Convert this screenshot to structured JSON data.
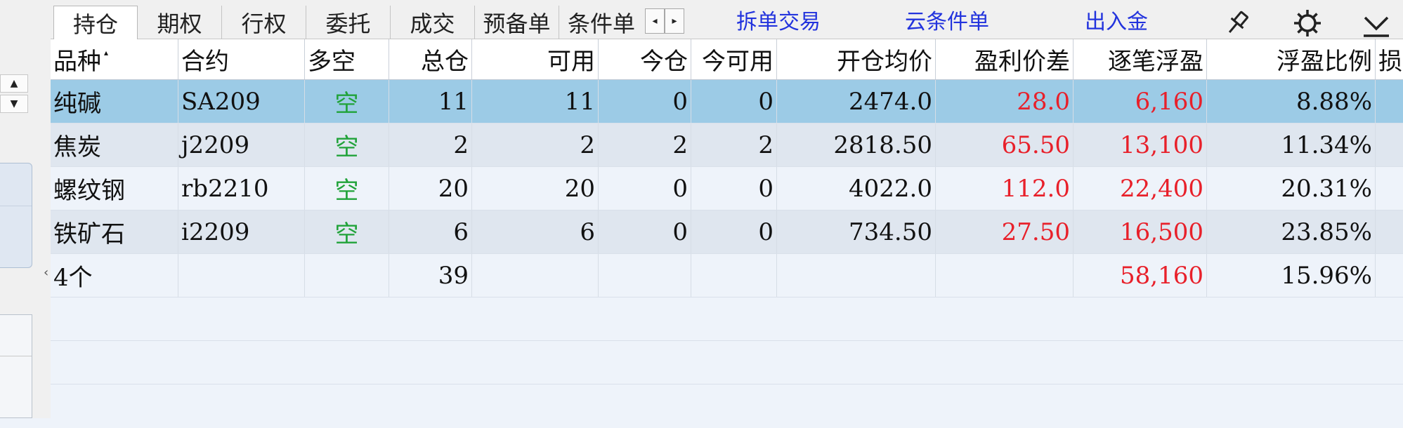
{
  "tabs": [
    {
      "label": "持仓",
      "active": true
    },
    {
      "label": "期权",
      "active": false
    },
    {
      "label": "行权",
      "active": false
    },
    {
      "label": "委托",
      "active": false
    },
    {
      "label": "成交",
      "active": false
    },
    {
      "label": "预备单",
      "active": false
    },
    {
      "label": "条件单",
      "active": false
    }
  ],
  "tab_scroll": {
    "left": "◂",
    "right": "▸"
  },
  "links": {
    "split_trade": "拆单交易",
    "cloud_condition": "云条件单",
    "deposit_withdraw": "出入金"
  },
  "icons": {
    "pin": "pin-icon",
    "settings": "gear-icon",
    "collapse": "chevron-down-icon"
  },
  "left_panel": {
    "spin_up": "▲",
    "spin_down": "▼",
    "collapse_arrow": "‹"
  },
  "colors": {
    "profit": "#e8202a",
    "short": "#21a33a",
    "selected_row": "#9ccbe6",
    "link": "#2233dd"
  },
  "table": {
    "headers": {
      "variety": "品种",
      "sort_indicator": "▴",
      "contract": "合约",
      "direction": "多空",
      "total": "总仓",
      "available": "可用",
      "today": "今仓",
      "today_available": "今可用",
      "avg_open_price": "开仓均价",
      "profit_spread": "盈利价差",
      "floating_pnl": "逐笔浮盈",
      "floating_ratio": "浮盈比例",
      "loss_partial": "损"
    },
    "rows": [
      {
        "variety": "纯碱",
        "contract": "SA209",
        "direction": "空",
        "total": "11",
        "available": "11",
        "today": "0",
        "today_available": "0",
        "avg_open_price": "2474.0",
        "profit_spread": "28.0",
        "floating_pnl": "6,160",
        "floating_ratio": "8.88%"
      },
      {
        "variety": "焦炭",
        "contract": "j2209",
        "direction": "空",
        "total": "2",
        "available": "2",
        "today": "2",
        "today_available": "2",
        "avg_open_price": "2818.50",
        "profit_spread": "65.50",
        "floating_pnl": "13,100",
        "floating_ratio": "11.34%"
      },
      {
        "variety": "螺纹钢",
        "contract": "rb2210",
        "direction": "空",
        "total": "20",
        "available": "20",
        "today": "0",
        "today_available": "0",
        "avg_open_price": "4022.0",
        "profit_spread": "112.0",
        "floating_pnl": "22,400",
        "floating_ratio": "20.31%"
      },
      {
        "variety": "铁矿石",
        "contract": "i2209",
        "direction": "空",
        "total": "6",
        "available": "6",
        "today": "0",
        "today_available": "0",
        "avg_open_price": "734.50",
        "profit_spread": "27.50",
        "floating_pnl": "16,500",
        "floating_ratio": "23.85%"
      }
    ],
    "summary": {
      "count": "4个",
      "total": "39",
      "floating_pnl": "58,160",
      "floating_ratio": "15.96%"
    }
  }
}
